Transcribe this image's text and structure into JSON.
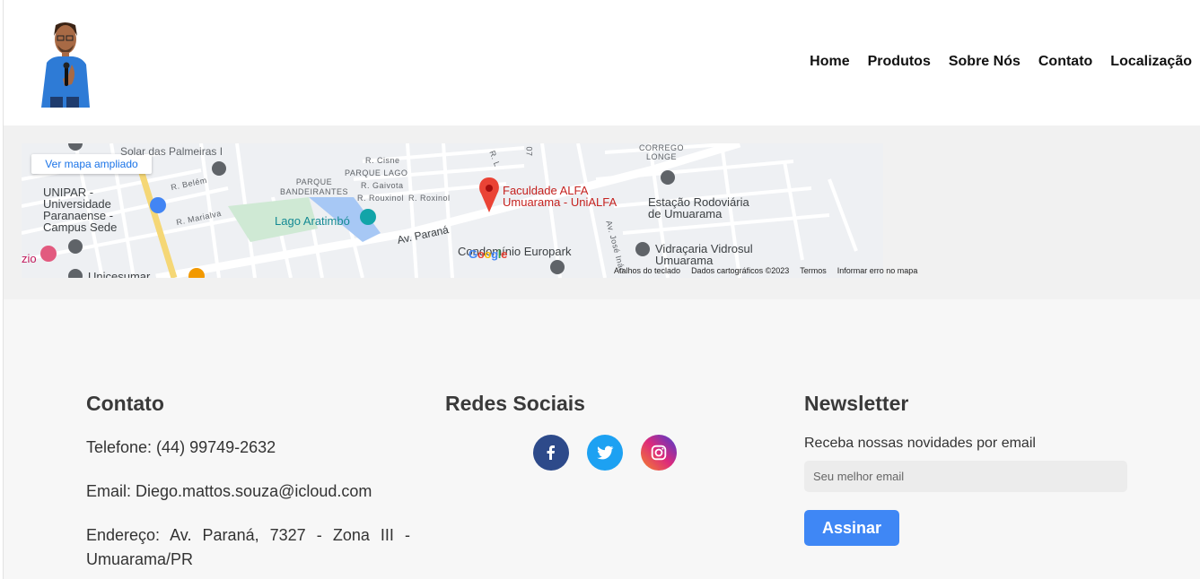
{
  "nav": {
    "items": [
      "Home",
      "Produtos",
      "Sobre Nós",
      "Contato",
      "Localização"
    ]
  },
  "map": {
    "enlarge_label": "Ver mapa ampliado",
    "pin_label_line1": "Faculdade ALFA",
    "pin_label_line2": "Umuarama - UniALFA",
    "places": {
      "unipar": [
        "UNIPAR -",
        "Universidade",
        "Paranaense -",
        "Campus Sede"
      ],
      "lago": "Lago Aratimbó",
      "estacao": [
        "Estação Rodoviária",
        "de Umuarama"
      ],
      "vidracaria": [
        "Vidraçaria Vidrosul",
        "Umuarama"
      ],
      "europark": "Condomínio Europark",
      "parque_bandeirantes": [
        "PARQUE",
        "BANDEIRANTES"
      ],
      "parque_lago": "PARQUE LAGO",
      "corrego": [
        "CORREGO",
        "LONGE"
      ],
      "solar": "Solar das Palmeiras I",
      "unicesumar": "Unicesumar",
      "r_cisne": "R. Cisne",
      "r_gaivota": "R. Gaivota",
      "r_rouxinol": "R. Rouxinol",
      "r_roxinol": "R. Roxinol",
      "r_belem": "R. Belém",
      "r_marialva": "R. Marialva",
      "av_parana": "Av. Paraná",
      "av_jose": "Av. José Inác",
      "r_l": "R. L",
      "zio": "zio",
      "num": "07"
    },
    "footer": [
      "Atalhos do teclado",
      "Dados cartográficos ©2023",
      "Termos",
      "Informar erro no mapa"
    ],
    "google": "Google"
  },
  "contact": {
    "title": "Contato",
    "phone": "Telefone: (44) 99749-2632",
    "email": "Email: Diego.mattos.souza@icloud.com",
    "address": "Endereço: Av. Paraná, 7327 - Zona III - Umuarama/PR"
  },
  "social": {
    "title": "Redes Sociais",
    "icons": [
      "facebook-icon",
      "twitter-icon",
      "instagram-icon"
    ],
    "colors": {
      "facebook": "#2d4a8a",
      "twitter": "#1da1f2",
      "instagram": "#c13584"
    }
  },
  "newsletter": {
    "title": "Newsletter",
    "description": "Receba nossas novidades por email",
    "email_placeholder": "Seu melhor email",
    "email_value": "",
    "submit_label": "Assinar"
  },
  "colors": {
    "accent": "#3f87f5",
    "map_pin": "#ea4335",
    "footer_bg": "#f7f7f7"
  }
}
